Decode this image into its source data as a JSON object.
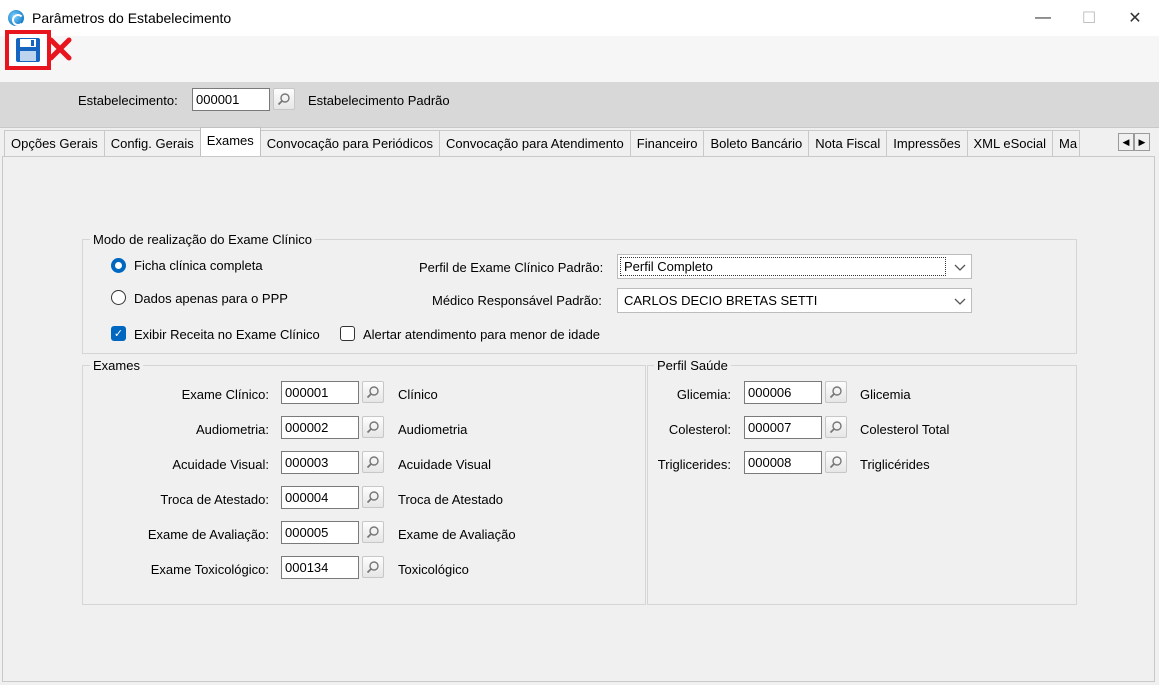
{
  "window": {
    "title": "Parâmetros do Estabelecimento",
    "minimize": "—",
    "maximize": "☐",
    "close": "✕"
  },
  "estabelecimento": {
    "label": "Estabelecimento:",
    "code": "000001",
    "name": "Estabelecimento Padrão"
  },
  "tabs": [
    "Opções Gerais",
    "Config. Gerais",
    "Exames",
    "Convocação para Periódicos",
    "Convocação para Atendimento",
    "Financeiro",
    "Boleto Bancário",
    "Nota Fiscal",
    "Impressões",
    "XML eSocial",
    "Ma"
  ],
  "modo": {
    "title": "Modo de realização do Exame Clínico",
    "radio_completa": "Ficha clínica completa",
    "radio_ppp": "Dados apenas para o PPP",
    "check_receita": "Exibir Receita no Exame Clínico",
    "check_menor": "Alertar atendimento para menor de idade",
    "perfil_label": "Perfil de Exame Clínico Padrão:",
    "perfil_value": "Perfil Completo",
    "medico_label": "Médico Responsável Padrão:",
    "medico_value": "CARLOS DECIO BRETAS SETTI"
  },
  "exames": {
    "title": "Exames",
    "rows": [
      {
        "label": "Exame Clínico:",
        "code": "000001",
        "desc": "Clínico"
      },
      {
        "label": "Audiometria:",
        "code": "000002",
        "desc": "Audiometria"
      },
      {
        "label": "Acuidade Visual:",
        "code": "000003",
        "desc": "Acuidade Visual"
      },
      {
        "label": "Troca de Atestado:",
        "code": "000004",
        "desc": "Troca de Atestado"
      },
      {
        "label": "Exame de Avaliação:",
        "code": "000005",
        "desc": "Exame de Avaliação"
      },
      {
        "label": "Exame Toxicológico:",
        "code": "000134",
        "desc": "Toxicológico"
      }
    ]
  },
  "perfil_saude": {
    "title": "Perfil Saúde",
    "rows": [
      {
        "label": "Glicemia:",
        "code": "000006",
        "desc": "Glicemia"
      },
      {
        "label": "Colesterol:",
        "code": "000007",
        "desc": "Colesterol Total"
      },
      {
        "label": "Triglicerides:",
        "code": "000008",
        "desc": "Triglicérides"
      }
    ]
  },
  "icons": {
    "app": "app-logo-icon",
    "save": "floppy-disk-icon",
    "cancel": "red-x-icon",
    "lookup": "magnifier-icon"
  },
  "colors": {
    "save_highlight": "#e8141e",
    "accent": "#0067c0"
  }
}
